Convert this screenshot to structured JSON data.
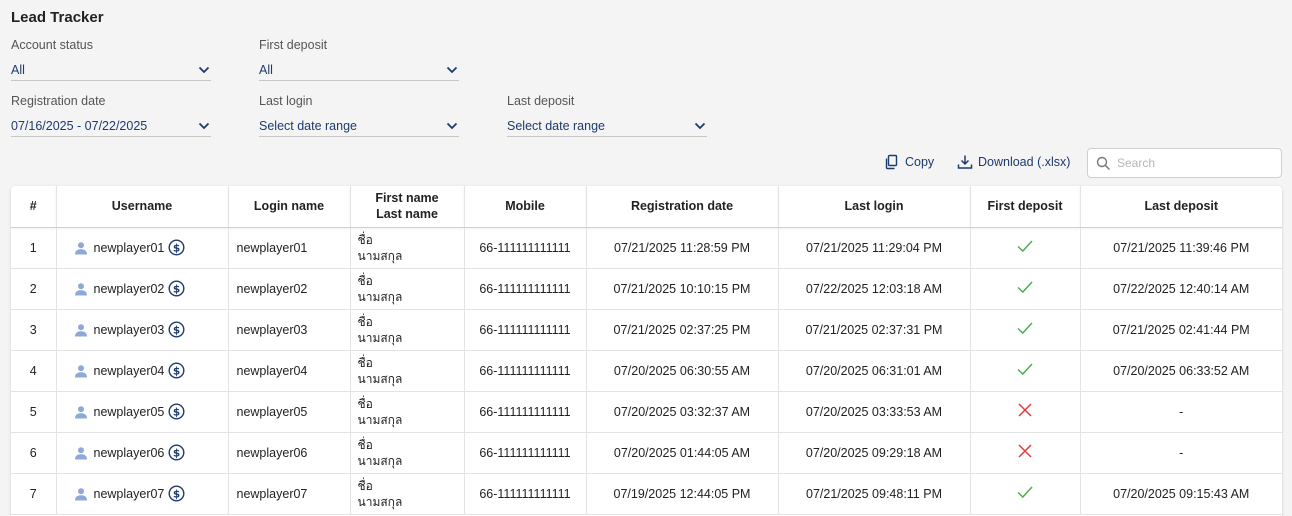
{
  "title": "Lead Tracker",
  "filters": {
    "account_status": {
      "label": "Account status",
      "value": "All"
    },
    "first_deposit": {
      "label": "First deposit",
      "value": "All"
    },
    "registration_date": {
      "label": "Registration date",
      "value": "07/16/2025 - 07/22/2025"
    },
    "last_login": {
      "label": "Last login",
      "value": "Select date range"
    },
    "last_deposit": {
      "label": "Last deposit",
      "value": "Select date range"
    }
  },
  "toolbar": {
    "copy_label": "Copy",
    "download_label": "Download (.xlsx)",
    "search_placeholder": "Search"
  },
  "colors": {
    "accent": "#1e3a6e",
    "check": "#4caf50",
    "cross": "#e53935",
    "user_icon": "#8ea9d8"
  },
  "table": {
    "headers": {
      "index": "#",
      "username": "Username",
      "login_name": "Login name",
      "first_name": "First name",
      "last_name": "Last name",
      "mobile": "Mobile",
      "registration_date": "Registration date",
      "last_login": "Last login",
      "first_deposit": "First deposit",
      "last_deposit": "Last deposit"
    },
    "rows": [
      {
        "index": "1",
        "username": "newplayer01",
        "login_name": "newplayer01",
        "first_name": "ชื่อ",
        "last_name": "นามสกุล",
        "mobile": "66-111111111111",
        "registration_date": "07/21/2025 11:28:59 PM",
        "last_login": "07/21/2025 11:29:04 PM",
        "first_deposit": true,
        "last_deposit": "07/21/2025 11:39:46 PM"
      },
      {
        "index": "2",
        "username": "newplayer02",
        "login_name": "newplayer02",
        "first_name": "ชื่อ",
        "last_name": "นามสกุล",
        "mobile": "66-111111111111",
        "registration_date": "07/21/2025 10:10:15 PM",
        "last_login": "07/22/2025 12:03:18 AM",
        "first_deposit": true,
        "last_deposit": "07/22/2025 12:40:14 AM"
      },
      {
        "index": "3",
        "username": "newplayer03",
        "login_name": "newplayer03",
        "first_name": "ชื่อ",
        "last_name": "นามสกุล",
        "mobile": "66-111111111111",
        "registration_date": "07/21/2025 02:37:25 PM",
        "last_login": "07/21/2025 02:37:31 PM",
        "first_deposit": true,
        "last_deposit": "07/21/2025 02:41:44 PM"
      },
      {
        "index": "4",
        "username": "newplayer04",
        "login_name": "newplayer04",
        "first_name": "ชื่อ",
        "last_name": "นามสกุล",
        "mobile": "66-111111111111",
        "registration_date": "07/20/2025 06:30:55 AM",
        "last_login": "07/20/2025 06:31:01 AM",
        "first_deposit": true,
        "last_deposit": "07/20/2025 06:33:52 AM"
      },
      {
        "index": "5",
        "username": "newplayer05",
        "login_name": "newplayer05",
        "first_name": "ชื่อ",
        "last_name": "นามสกุล",
        "mobile": "66-111111111111",
        "registration_date": "07/20/2025 03:32:37 AM",
        "last_login": "07/20/2025 03:33:53 AM",
        "first_deposit": false,
        "last_deposit": "-"
      },
      {
        "index": "6",
        "username": "newplayer06",
        "login_name": "newplayer06",
        "first_name": "ชื่อ",
        "last_name": "นามสกุล",
        "mobile": "66-111111111111",
        "registration_date": "07/20/2025 01:44:05 AM",
        "last_login": "07/20/2025 09:29:18 AM",
        "first_deposit": false,
        "last_deposit": "-"
      },
      {
        "index": "7",
        "username": "newplayer07",
        "login_name": "newplayer07",
        "first_name": "ชื่อ",
        "last_name": "นามสกุล",
        "mobile": "66-111111111111",
        "registration_date": "07/19/2025 12:44:05 PM",
        "last_login": "07/21/2025 09:48:11 PM",
        "first_deposit": true,
        "last_deposit": "07/20/2025 09:15:43 AM"
      }
    ]
  }
}
